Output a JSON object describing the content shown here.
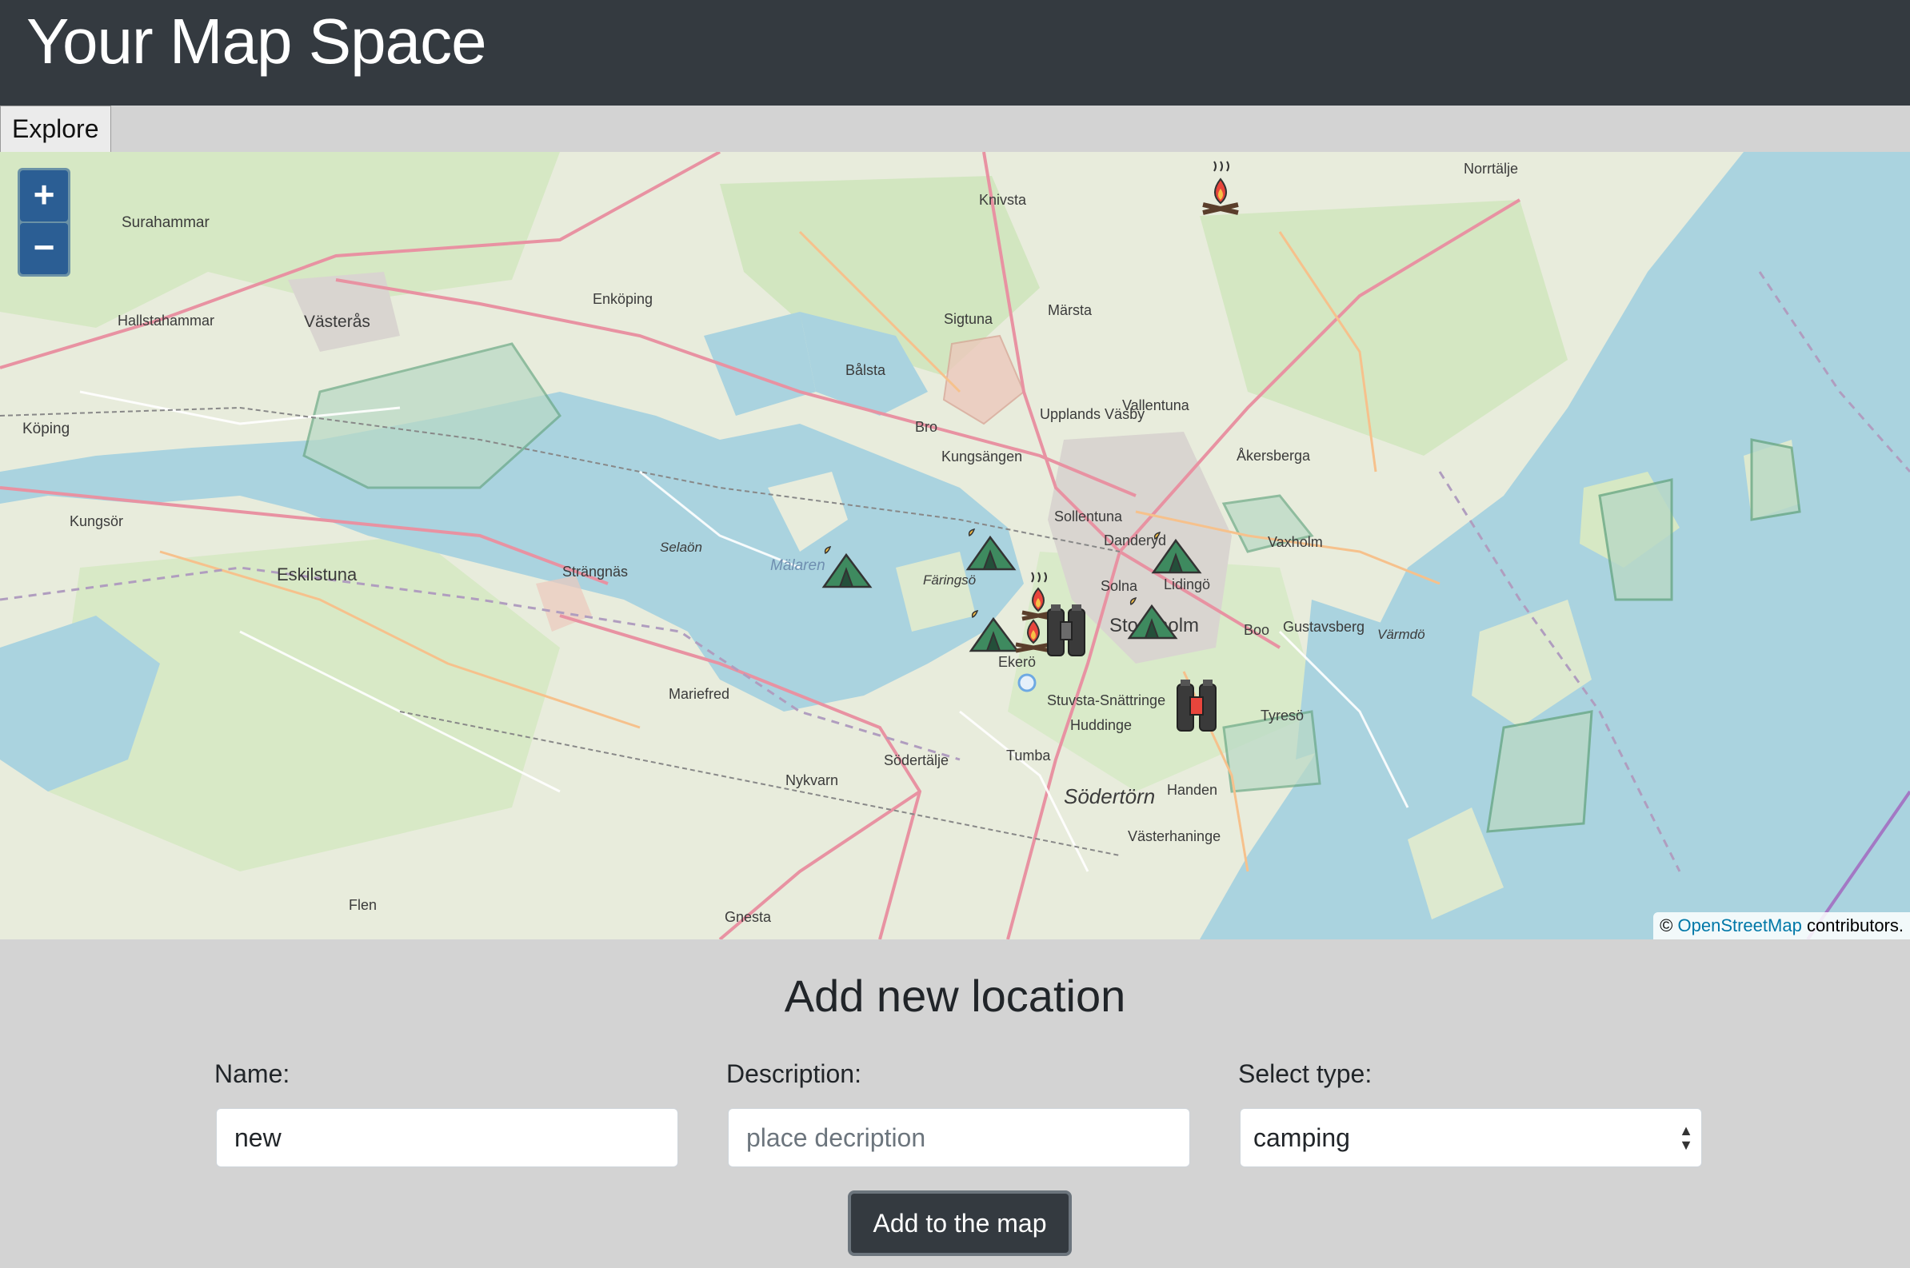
{
  "header": {
    "title": "Your Map Space"
  },
  "tabs": [
    {
      "label": "Explore"
    }
  ],
  "map": {
    "zoom_in_label": "+",
    "zoom_out_label": "−",
    "attribution_prefix": "©",
    "attribution_link": "OpenStreetMap",
    "attribution_suffix": "contributors.",
    "place_labels": [
      "Surahammar",
      "Knivsta",
      "Norrtälje",
      "Enköping",
      "Hallstahammar",
      "Västerås",
      "Sigtuna",
      "Märsta",
      "Bålsta",
      "Köping",
      "Upplands Väsby",
      "Vallentuna",
      "Bro",
      "Kungsängen",
      "Åkersberga",
      "Kungsör",
      "Sollentuna",
      "Danderyd",
      "Vaxholm",
      "Selaön",
      "Mälaren",
      "Eskilstuna",
      "Strängnäs",
      "Färingsö",
      "Solna",
      "Lidingö",
      "Stockholm",
      "Boo",
      "Gustavsberg",
      "Värmdö",
      "Ekerö",
      "Mariefred",
      "Stuvsta-Snättringe",
      "Huddinge",
      "Tyresö",
      "Södertälje",
      "Tumba",
      "Nykvarn",
      "Södertörn",
      "Handen",
      "Västerhaninge",
      "Flen",
      "Gnesta"
    ],
    "markers": [
      {
        "type": "campfire-icon"
      },
      {
        "type": "tent-icon"
      },
      {
        "type": "tent-icon"
      },
      {
        "type": "tent-icon"
      },
      {
        "type": "campfire-icon"
      },
      {
        "type": "tent-icon"
      },
      {
        "type": "campfire-icon"
      },
      {
        "type": "binoculars-icon"
      },
      {
        "type": "tent-icon"
      },
      {
        "type": "binoculars-icon"
      }
    ]
  },
  "form": {
    "heading": "Add new location",
    "name_label": "Name:",
    "name_value": "new",
    "description_label": "Description:",
    "description_placeholder": "place decription",
    "type_label": "Select type:",
    "type_selected": "camping",
    "submit_label": "Add to the map"
  }
}
